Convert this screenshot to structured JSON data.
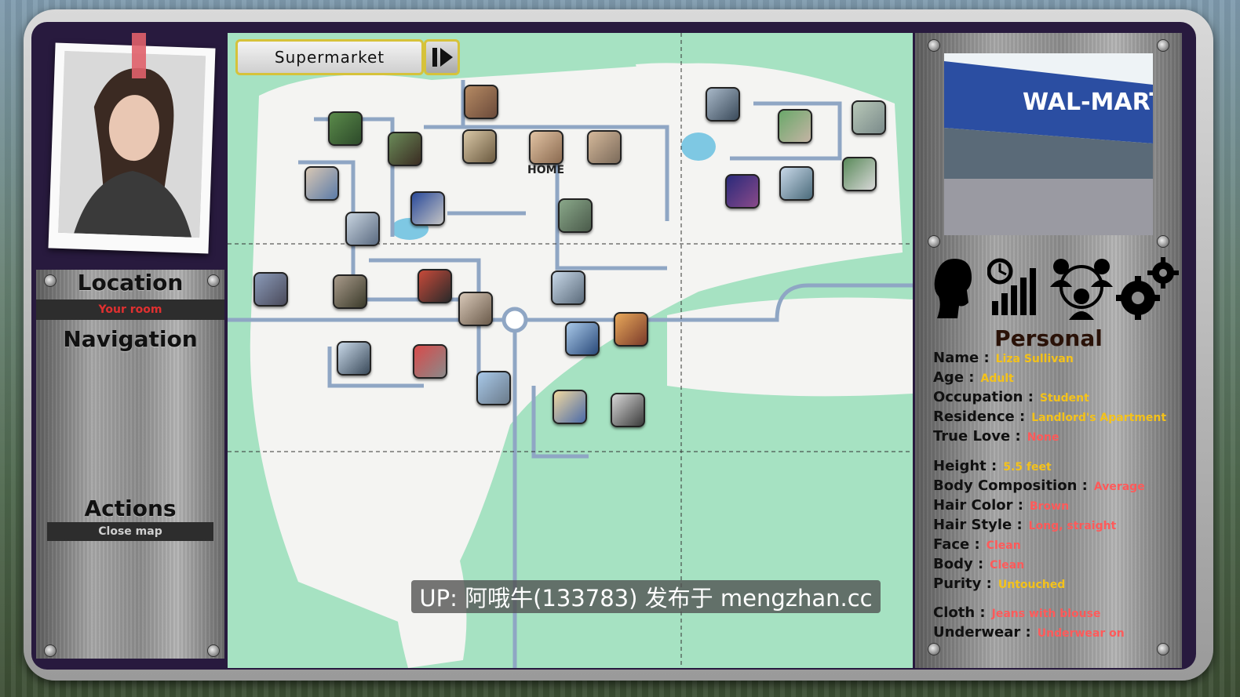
{
  "left": {
    "location_title": "Location",
    "current_location": "Your room",
    "navigation_title": "Navigation",
    "actions_title": "Actions",
    "close_map_label": "Close map"
  },
  "map": {
    "selected_location": "Supermarket",
    "home_label": "HOME",
    "pin_count": 27
  },
  "right": {
    "category_icons": [
      "profile-silhouette-icon",
      "stats-chart-icon",
      "relationships-icon",
      "settings-gears-icon"
    ],
    "section_title": "Personal",
    "fields": [
      {
        "label": "Name :",
        "value": "Liza Sullivan",
        "color": "yellow"
      },
      {
        "label": "Age :",
        "value": "Adult",
        "color": "yellow"
      },
      {
        "label": "Occupation :",
        "value": "Student",
        "color": "yellow"
      },
      {
        "label": "Residence :",
        "value": "Landlord's Apartment",
        "color": "yellow"
      },
      {
        "label": "True Love :",
        "value": "None",
        "color": "red"
      },
      {
        "label": "Height :",
        "value": "5.5 feet",
        "color": "yellow"
      },
      {
        "label": "Body Composition :",
        "value": "Average",
        "color": "red"
      },
      {
        "label": "Hair Color :",
        "value": "Brown",
        "color": "red"
      },
      {
        "label": "Hair Style :",
        "value": "Long, straight",
        "color": "red"
      },
      {
        "label": "Face :",
        "value": "Clean",
        "color": "red"
      },
      {
        "label": "Body :",
        "value": "Clean",
        "color": "red"
      },
      {
        "label": "Purity :",
        "value": "Untouched",
        "color": "yellow"
      },
      {
        "label": "Cloth :",
        "value": "Jeans with blouse",
        "color": "red"
      },
      {
        "label": "Underwear :",
        "value": "Underwear on",
        "color": "red"
      }
    ]
  },
  "watermark": "UP: 阿哦牛(133783) 发布于 mengzhan.cc",
  "colors": {
    "accent_yellow": "#f4c21a",
    "accent_red": "#ff5a5a",
    "map_green": "#a6e2c2",
    "road": "#8fa6c4"
  }
}
